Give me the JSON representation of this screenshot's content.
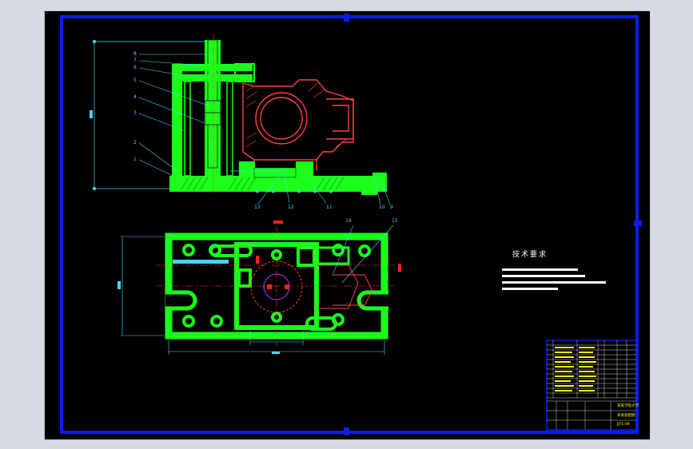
{
  "drawing": {
    "colors": {
      "background": "#000000",
      "frame": "#0a1ee6",
      "part": "#1aff1a",
      "dimension": "#3fd7ff",
      "center_line": "#ff3030",
      "section": "#ff4040",
      "hatch": "#00ff00",
      "text": "#ffffff",
      "title_block_text": "#ffff00"
    },
    "balloons": {
      "left": [
        "8",
        "7",
        "6",
        "5",
        "4",
        "3",
        "2",
        "1"
      ],
      "bottom": [
        "13",
        "12",
        "11",
        "10",
        "9"
      ],
      "plan": [
        "14",
        "15"
      ]
    },
    "technical_requirements": {
      "title": "技术要求"
    },
    "title_block": {
      "school": "某某学院大学",
      "drawing_name": "夹具装配图",
      "drawing_no": "JJT1-09"
    }
  }
}
